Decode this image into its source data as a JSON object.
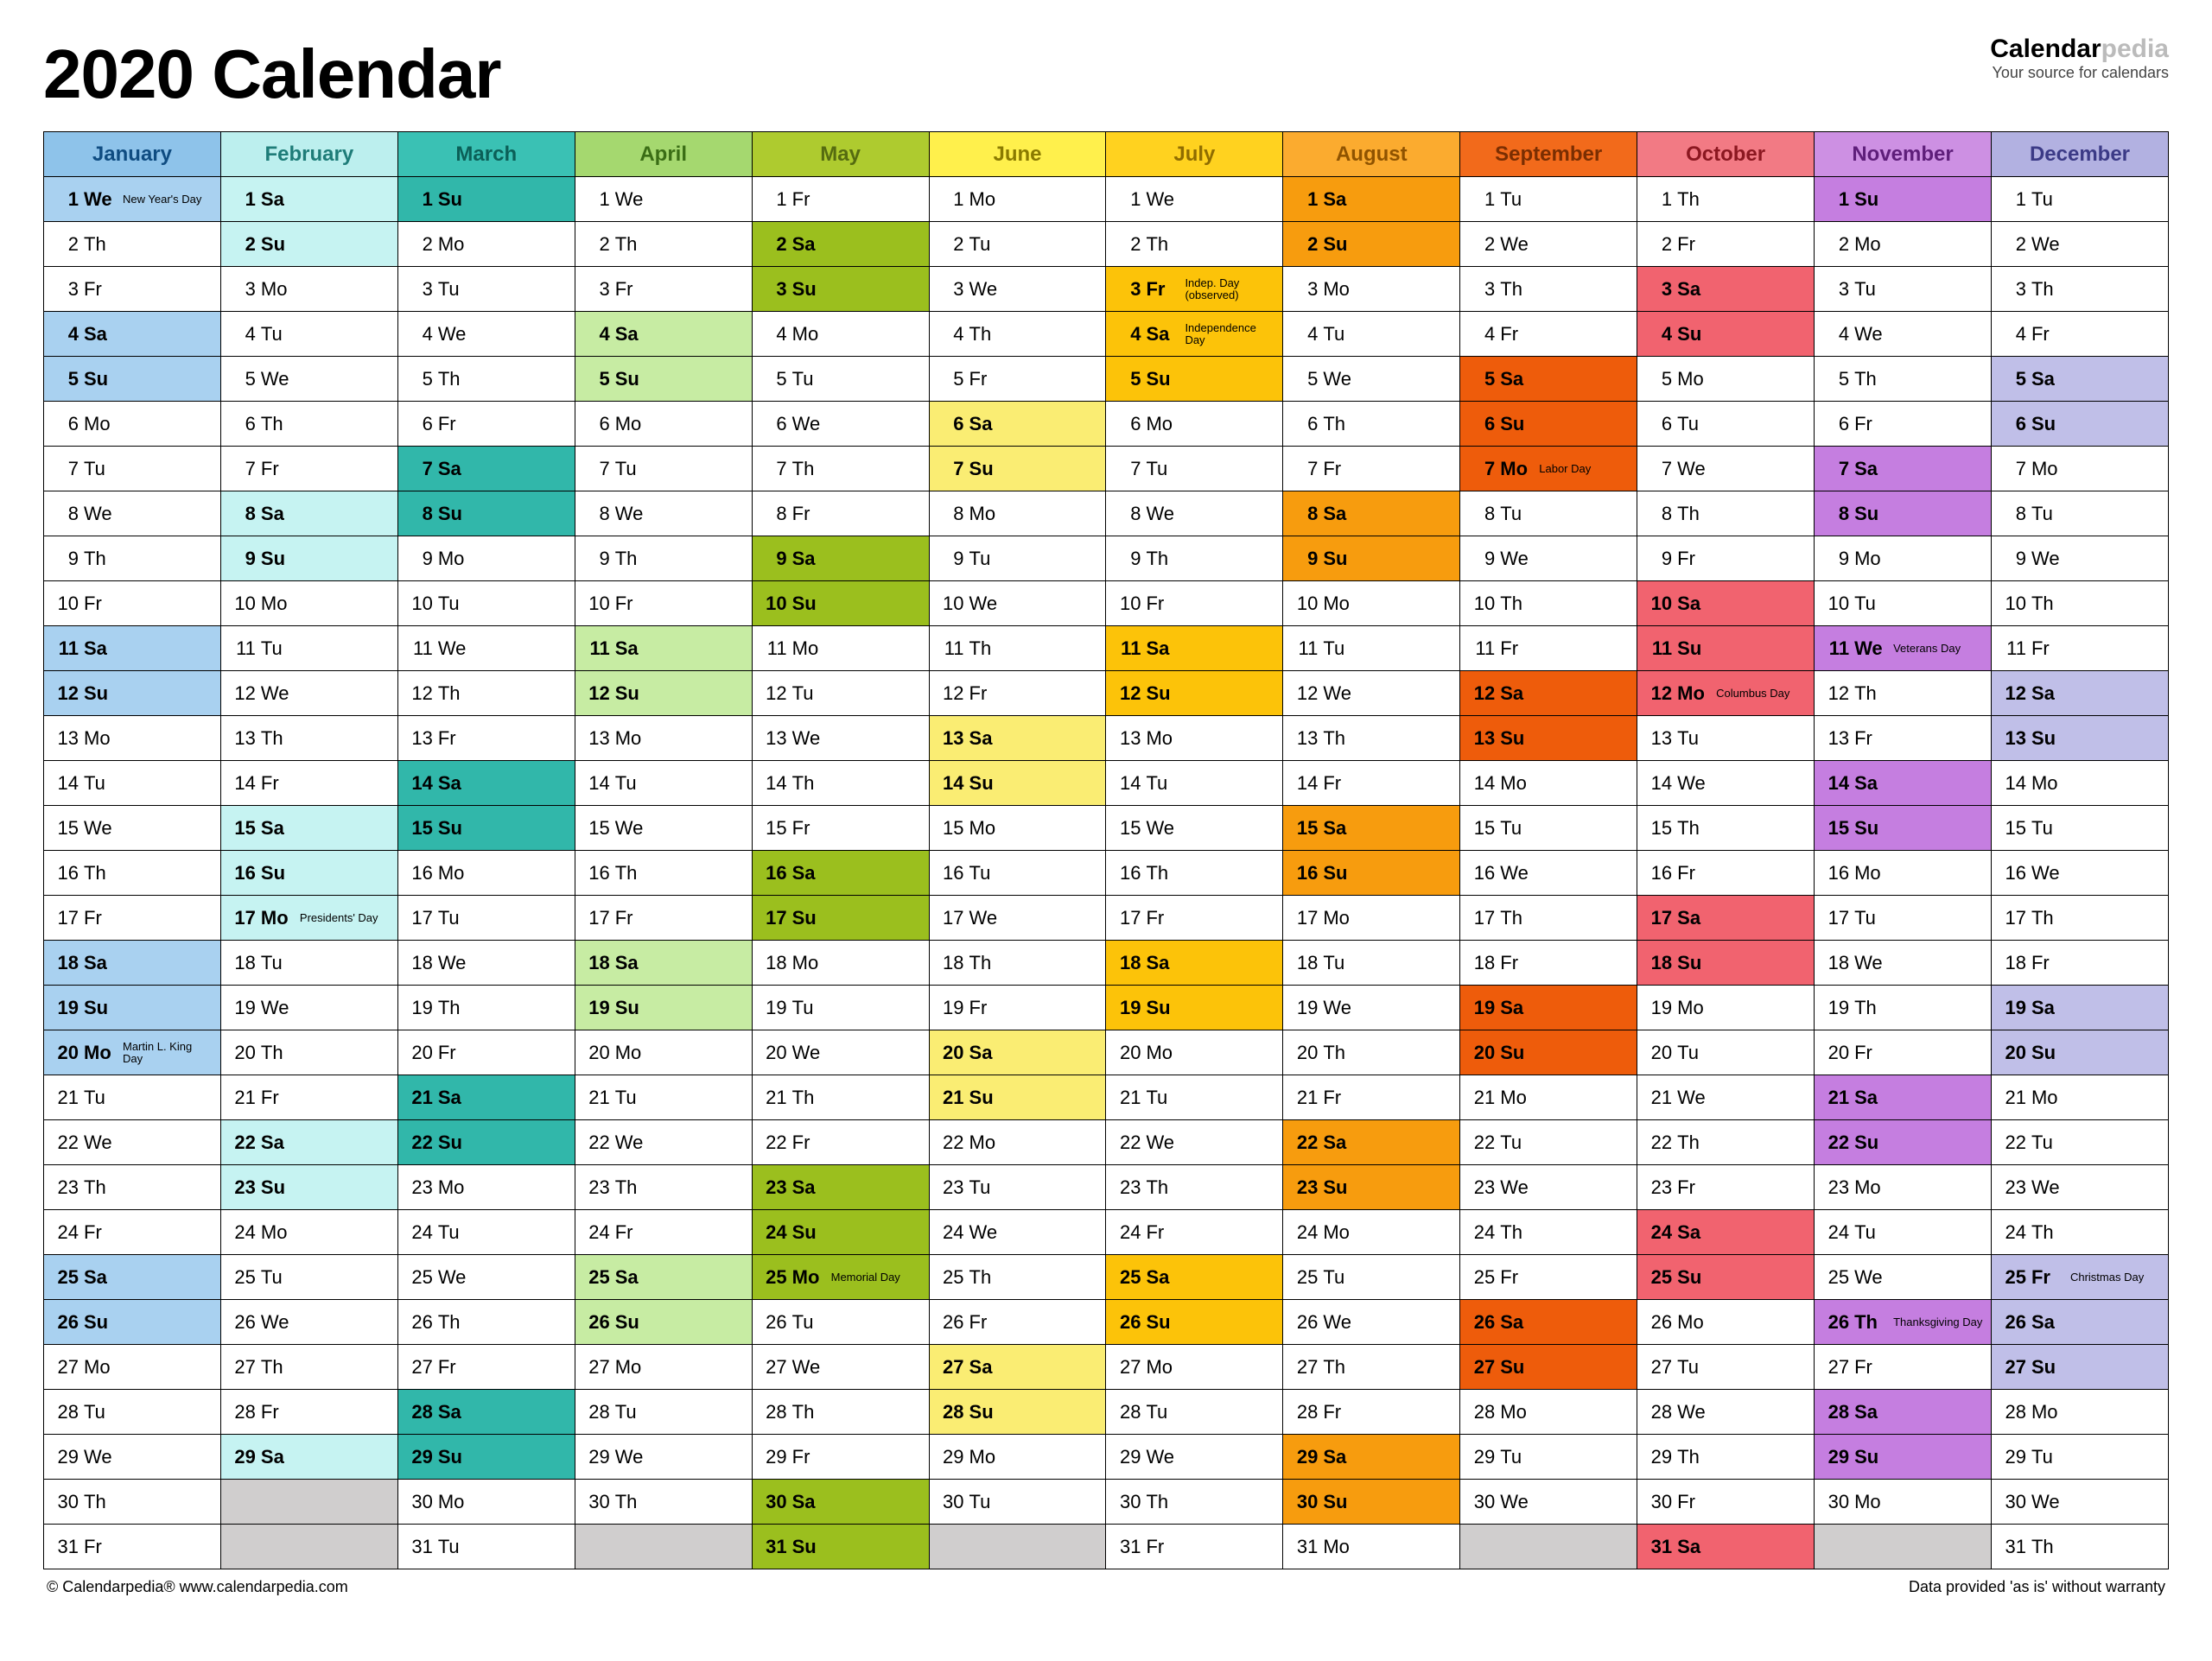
{
  "title": "2020 Calendar",
  "brand": {
    "name1": "Calendar",
    "name2": "pedia",
    "tag": "Your source for calendars"
  },
  "footer": {
    "left": "© Calendarpedia®   www.calendarpedia.com",
    "right": "Data provided 'as is' without warranty"
  },
  "dows": [
    "Mo",
    "Tu",
    "We",
    "Th",
    "Fr",
    "Sa",
    "Su"
  ],
  "months": [
    {
      "name": "January",
      "start": 2,
      "len": 31,
      "head": {
        "bg": "#8ec3ea",
        "fg": "#0f4c81"
      },
      "weekend": "#a9d1f0",
      "holiday": "#a9d1f0",
      "holidays": {
        "1": "New Year's Day",
        "20": "Martin L. King Day"
      }
    },
    {
      "name": "February",
      "start": 5,
      "len": 29,
      "head": {
        "bg": "#bcefee",
        "fg": "#1e7c78"
      },
      "weekend": "#c6f3f2",
      "holiday": "#c6f3f2",
      "holidays": {
        "17": "Presidents' Day"
      }
    },
    {
      "name": "March",
      "start": 6,
      "len": 31,
      "head": {
        "bg": "#3ac1b4",
        "fg": "#0b5f57"
      },
      "weekend": "#31b7aa",
      "holiday": "#31b7aa",
      "holidays": {}
    },
    {
      "name": "April",
      "start": 2,
      "len": 30,
      "head": {
        "bg": "#a5d86f",
        "fg": "#3a6d15"
      },
      "weekend": "#c7eca3",
      "holiday": "#c7eca3",
      "holidays": {}
    },
    {
      "name": "May",
      "start": 4,
      "len": 31,
      "head": {
        "bg": "#aecb2f",
        "fg": "#556b10"
      },
      "weekend": "#9bbf1e",
      "holiday": "#9bbf1e",
      "holidays": {
        "25": "Memorial Day"
      }
    },
    {
      "name": "June",
      "start": 0,
      "len": 30,
      "head": {
        "bg": "#fff04c",
        "fg": "#8a7a00"
      },
      "weekend": "#faed73",
      "holiday": "#faed73",
      "holidays": {}
    },
    {
      "name": "July",
      "start": 2,
      "len": 31,
      "head": {
        "bg": "#ffd21f",
        "fg": "#8f6c00"
      },
      "weekend": "#fcc309",
      "holiday": "#fcc309",
      "holidays": {
        "3": "Indep. Day (observed)",
        "4": "Independence Day"
      }
    },
    {
      "name": "August",
      "start": 5,
      "len": 31,
      "head": {
        "bg": "#fbab2f",
        "fg": "#8f5300"
      },
      "weekend": "#f79c0e",
      "holiday": "#f79c0e",
      "holidays": {}
    },
    {
      "name": "September",
      "start": 1,
      "len": 30,
      "head": {
        "bg": "#f26a1b",
        "fg": "#7a2e02"
      },
      "weekend": "#ee5c0b",
      "holiday": "#ee5c0b",
      "holidays": {
        "7": "Labor Day"
      }
    },
    {
      "name": "October",
      "start": 3,
      "len": 31,
      "head": {
        "bg": "#f27a84",
        "fg": "#8b1720"
      },
      "weekend": "#f1636f",
      "holiday": "#f1636f",
      "holidays": {
        "12": "Columbus Day"
      }
    },
    {
      "name": "November",
      "start": 6,
      "len": 30,
      "head": {
        "bg": "#cd90e3",
        "fg": "#5e1e7a"
      },
      "weekend": "#c57ee0",
      "holiday": "#c57ee0",
      "holidays": {
        "11": "Veterans Day",
        "26": "Thanksgiving Day"
      }
    },
    {
      "name": "December",
      "start": 1,
      "len": 31,
      "head": {
        "bg": "#b2b1e1",
        "fg": "#3b3a86"
      },
      "weekend": "#c0bfe8",
      "holiday": "#c0bfe8",
      "holidays": {
        "25": "Christmas Day"
      }
    }
  ]
}
